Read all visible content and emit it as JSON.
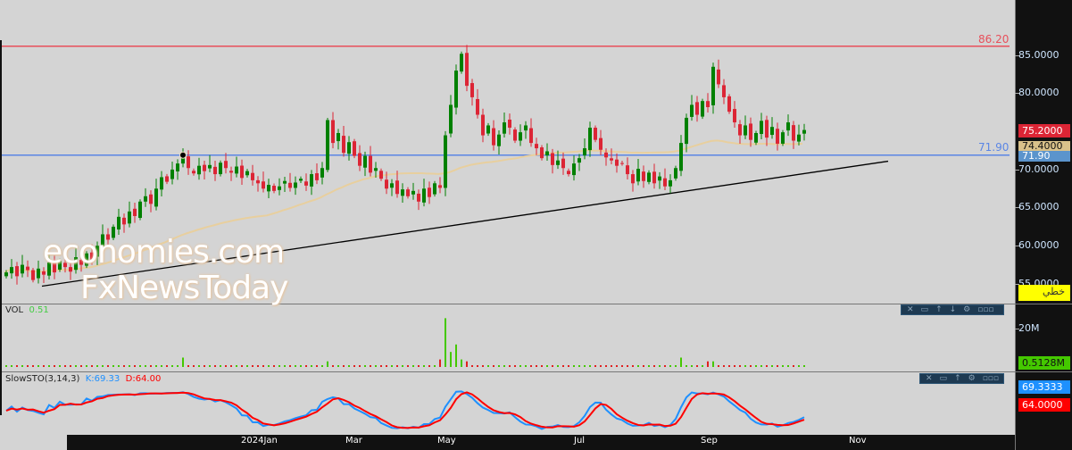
{
  "chart_data": {
    "type": "candlestick",
    "x_ticks": [
      "2024Jan",
      "Mar",
      "May",
      "Jul",
      "Sep",
      "Nov"
    ],
    "y_ticks": [
      "85.0000",
      "80.0000",
      "70.0000",
      "65.0000",
      "60.0000",
      "55.0000"
    ],
    "ylim": [
      53.5,
      89
    ],
    "close": [
      56.5,
      57.2,
      56,
      57.5,
      56.8,
      55.5,
      57,
      56.2,
      57.8,
      56.5,
      58,
      57.2,
      56.6,
      58.5,
      57.5,
      59,
      58.2,
      60,
      61.5,
      60.8,
      62.5,
      63.8,
      62.8,
      64.5,
      63.9,
      65.8,
      66.5,
      65.5,
      67.5,
      69,
      68.4,
      70,
      70.8,
      71.5,
      70.2,
      69.5,
      70.5,
      69.8,
      70.6,
      69.4,
      70.9,
      70.2,
      69.6,
      70.4,
      68.9,
      69.8,
      68.6,
      68.2,
      67.5,
      68,
      67.2,
      67.8,
      68.5,
      67.6,
      68.3,
      68.8,
      67.9,
      69.4,
      68.6,
      70.2,
      76.5,
      73.5,
      74.8,
      72.2,
      73.6,
      71.8,
      70.5,
      71.8,
      69.6,
      70.2,
      68.8,
      67.5,
      68.2,
      66.8,
      67.4,
      66.5,
      67.2,
      65.8,
      67.5,
      66.4,
      68.2,
      67.6,
      74.5,
      78.5,
      83,
      85.2,
      81,
      79.5,
      77.2,
      74.5,
      75.8,
      73.2,
      74.6,
      76.2,
      75.5,
      73.8,
      74.9,
      75.8,
      73.5,
      72.8,
      71.5,
      72.4,
      70.6,
      71.2,
      70.2,
      69.4,
      70.8,
      71.5,
      72.8,
      75.5,
      73.9,
      72.6,
      71.6,
      71.2,
      70.5,
      70.8,
      69.4,
      68.2,
      70.1,
      68.5,
      69.6,
      68.2,
      69.1,
      67.8,
      68.6,
      70.2,
      73.5,
      76.8,
      78.5,
      77.2,
      79,
      78.2,
      83.5,
      81.2,
      79.5,
      77.6,
      76.2,
      74.5,
      75.8,
      73.9,
      74.8,
      76.4,
      74.2,
      75.6,
      73.4,
      74.9,
      76.2,
      73.8,
      74.6,
      75.2
    ],
    "ma_period": 50,
    "hlines": [
      {
        "value": 86.2,
        "label": "86.20",
        "color": "#e8505b"
      },
      {
        "value": 71.9,
        "label": "71.90",
        "color": "#5b86e5"
      }
    ],
    "trendline": {
      "from_index": 7,
      "from_value": 54.7,
      "to_index": 165,
      "to_value": 71.1
    },
    "marker": {
      "index": 33,
      "value": 71.9
    },
    "volume": {
      "label": "VOL",
      "value": "0.51",
      "default_m": 0.6,
      "scale_tick": "20M",
      "spikes": [
        {
          "i": 33,
          "v": 5
        },
        {
          "i": 60,
          "v": 3
        },
        {
          "i": 81,
          "v": 4
        },
        {
          "i": 82,
          "v": 26
        },
        {
          "i": 83,
          "v": 8
        },
        {
          "i": 84,
          "v": 12
        },
        {
          "i": 85,
          "v": 4
        },
        {
          "i": 86,
          "v": 3
        },
        {
          "i": 126,
          "v": 5
        },
        {
          "i": 131,
          "v": 3
        },
        {
          "i": 132,
          "v": 3
        }
      ]
    },
    "stoch": {
      "label": "SlowSTO(3,14,3)",
      "k_label": "K:69.33",
      "d_label": "D:64.00"
    }
  },
  "axis_tags": {
    "last": "75.2000",
    "ma": "74.4000",
    "line": "71.90",
    "volume": "0.5128M",
    "k": "69.3333",
    "d": "64.0000",
    "style": "خطي"
  },
  "watermark": {
    "line1": "economies.com",
    "line2": "FxNewsToday"
  },
  "toolbar_icons": [
    "close-icon",
    "maximize-icon",
    "move-up-icon",
    "move-down-icon",
    "settings-icon",
    "more-icon"
  ],
  "colors": {
    "up": "#008000",
    "down": "#dc2535",
    "ma": "#e8cf9e",
    "k": "#1e90ff",
    "d": "#ff0000"
  }
}
